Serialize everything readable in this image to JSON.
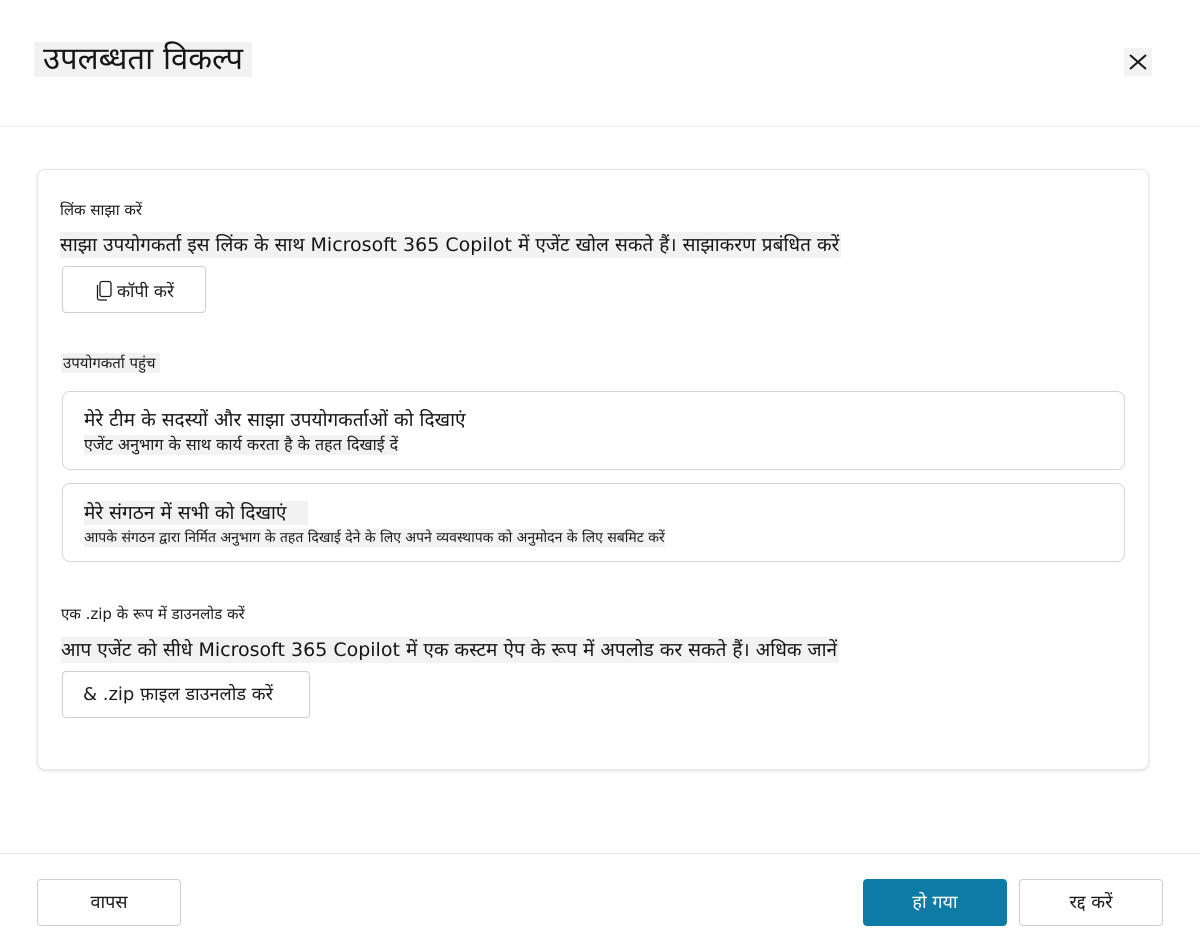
{
  "dialog": {
    "title": "उपलब्धता विकल्प",
    "close_icon": "close-icon"
  },
  "share_link": {
    "label": "लिंक साझा करें",
    "description": "साझा उपयोगकर्ता इस लिंक के साथ Microsoft 365 Copilot में एजेंट खोल सकते हैं। साझाकरण प्रबंधित करें",
    "copy_button_label": "कॉपी करें",
    "copy_icon": "copy-icon"
  },
  "user_access": {
    "label": "उपयोगकर्ता पहुंच",
    "options": [
      {
        "title": "मेरे टीम के सदस्यों और साझा उपयोगकर्ताओं को दिखाएं",
        "subtitle": "एजेंट अनुभाग के साथ कार्य करता है के तहत दिखाई दें"
      },
      {
        "title": "मेरे संगठन में सभी को दिखाएं",
        "subtitle": "आपके संगठन द्वारा निर्मित अनुभाग के तहत दिखाई देने के लिए अपने व्यवस्थापक को अनुमोदन के लिए सबमिट करें"
      }
    ]
  },
  "download": {
    "label": "एक .zip के रूप में डाउनलोड करें",
    "description": "आप एजेंट को सीधे Microsoft 365 Copilot में एक कस्टम ऐप के रूप में अपलोड कर सकते हैं। अधिक जानें",
    "button_label": "& .zip फ़ाइल डाउनलोड करें"
  },
  "footer": {
    "back_label": "वापस",
    "done_label": "हो गया",
    "cancel_label": "रद्द करें"
  },
  "colors": {
    "primary": "#0e7aa6",
    "highlight": "#f2f2f2",
    "border": "#d6d6d6"
  }
}
